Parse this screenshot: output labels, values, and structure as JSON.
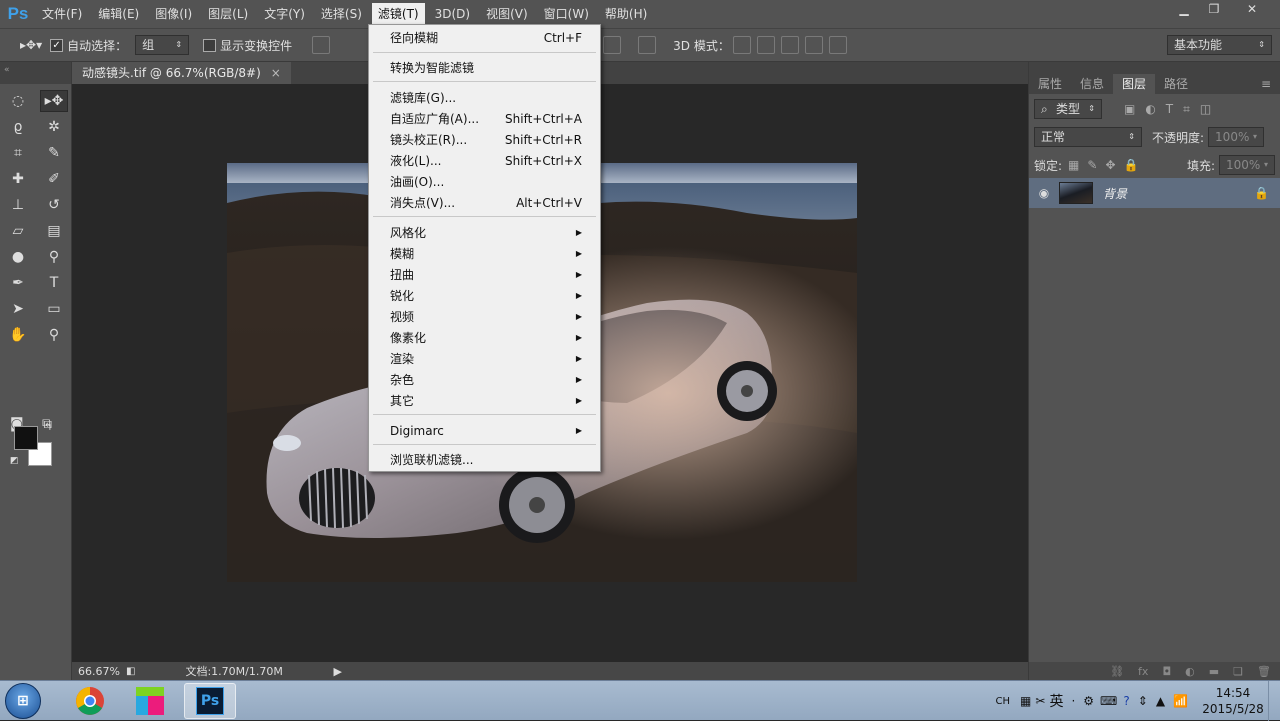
{
  "app": {
    "logo": "Ps"
  },
  "menubar": [
    "文件(F)",
    "编辑(E)",
    "图像(I)",
    "图层(L)",
    "文字(Y)",
    "选择(S)",
    "滤镜(T)",
    "3D(D)",
    "视图(V)",
    "窗口(W)",
    "帮助(H)"
  ],
  "options": {
    "auto_select_label": "自动选择：",
    "auto_select_value": "组",
    "show_transform_label": "显示变换控件",
    "mode_3d_label": "3D 模式：",
    "workspace": "基本功能"
  },
  "document": {
    "tab_title": "动感镜头.tif @ 66.7%(RGB/8#)",
    "close": "×"
  },
  "status": {
    "zoom": "66.67%",
    "doc_size": "文档:1.70M/1.70M"
  },
  "panel": {
    "tabs": [
      "属性",
      "信息",
      "图层",
      "路径"
    ],
    "active_tab": "图层",
    "filter_kind": "类型",
    "blend_mode": "正常",
    "opacity_label": "不透明度:",
    "opacity_value": "100%",
    "lock_label": "锁定:",
    "fill_label": "填充:",
    "fill_value": "100%",
    "layer_name": "背景"
  },
  "filter_menu": {
    "items": [
      {
        "label": "径向模糊",
        "shortcut": "Ctrl+F"
      },
      {
        "label": "转换为智能滤镜",
        "shortcut": ""
      },
      {
        "label": "滤镜库(G)...",
        "shortcut": ""
      },
      {
        "label": "自适应广角(A)...",
        "shortcut": "Shift+Ctrl+A"
      },
      {
        "label": "镜头校正(R)...",
        "shortcut": "Shift+Ctrl+R"
      },
      {
        "label": "液化(L)...",
        "shortcut": "Shift+Ctrl+X"
      },
      {
        "label": "油画(O)...",
        "shortcut": ""
      },
      {
        "label": "消失点(V)...",
        "shortcut": "Alt+Ctrl+V"
      },
      {
        "label": "风格化",
        "shortcut": ""
      },
      {
        "label": "模糊",
        "shortcut": ""
      },
      {
        "label": "扭曲",
        "shortcut": ""
      },
      {
        "label": "锐化",
        "shortcut": ""
      },
      {
        "label": "视频",
        "shortcut": ""
      },
      {
        "label": "像素化",
        "shortcut": ""
      },
      {
        "label": "渲染",
        "shortcut": ""
      },
      {
        "label": "杂色",
        "shortcut": ""
      },
      {
        "label": "其它",
        "shortcut": ""
      },
      {
        "label": "Digimarc",
        "shortcut": ""
      },
      {
        "label": "浏览联机滤镜...",
        "shortcut": ""
      }
    ]
  },
  "taskbar": {
    "ime_code": "CH",
    "ime_lang": "英",
    "time": "14:54",
    "date": "2015/5/28",
    "ps_task": "Ps"
  }
}
